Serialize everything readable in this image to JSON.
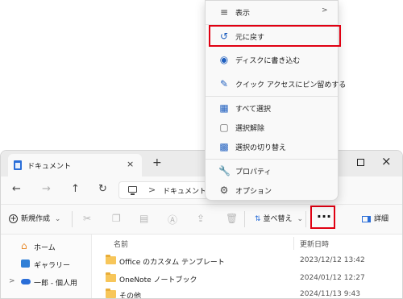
{
  "window": {
    "tab_title": "ドキュメント",
    "tab_close": "×",
    "new_tab": "+",
    "nav": {
      "back": "←",
      "forward": "→",
      "up": "↑",
      "refresh": "↻"
    },
    "address": {
      "separator": ">",
      "current": "ドキュメント",
      "separator_end": ">"
    }
  },
  "toolbar": {
    "new_label": "新規作成",
    "new_chevron": "⌄",
    "sort_label": "並べ替え",
    "sort_chevron": "⌄",
    "more_label": "···",
    "details_label": "詳細"
  },
  "sidebar": {
    "items": [
      {
        "label": "ホーム",
        "icon": "home-icon"
      },
      {
        "label": "ギャラリー",
        "icon": "gallery-icon"
      },
      {
        "label": "一郎 - 個人用",
        "icon": "onedrive-cloud-icon",
        "expander": ">"
      }
    ]
  },
  "files": {
    "col_name": "名前",
    "col_date": "更新日時",
    "rows": [
      {
        "name": "Office のカスタム テンプレート",
        "date": "2023/12/12 13:42",
        "icon": "folder-icon"
      },
      {
        "name": "OneNote ノートブック",
        "date": "2024/01/12 12:27",
        "icon": "folder-icon"
      },
      {
        "name": "その他",
        "date": "2024/11/13 9:43",
        "icon": "folder-icon"
      }
    ]
  },
  "menu": {
    "view": {
      "label": "表示",
      "chevron": ">"
    },
    "undo": {
      "label": "元に戻す"
    },
    "burn": {
      "label": "ディスクに書き込む"
    },
    "pin": {
      "label": "クイック アクセスにピン留めする"
    },
    "select_all": {
      "label": "すべて選択"
    },
    "select_none": {
      "label": "選択解除"
    },
    "invert": {
      "label": "選択の切り替え"
    },
    "properties": {
      "label": "プロパティ"
    },
    "options": {
      "label": "オプション"
    }
  },
  "colors": {
    "highlight": "#e00012",
    "accent": "#1f5fbf",
    "folder": "#f7c65a"
  }
}
